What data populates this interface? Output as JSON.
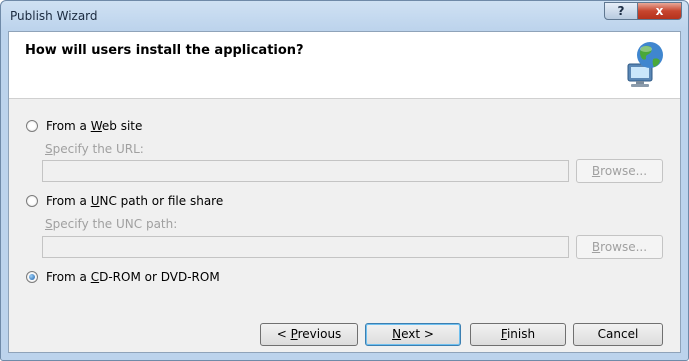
{
  "window": {
    "title": "Publish Wizard",
    "help": "?",
    "close": "x"
  },
  "header": {
    "question": "How will users install the application?"
  },
  "options": {
    "web": {
      "pre": "From a ",
      "key": "W",
      "post": "eb site",
      "selected": false
    },
    "web_url": {
      "key": "S",
      "post": "pecify the URL:",
      "value": "",
      "browse_pre": "",
      "browse_key": "B",
      "browse_post": "rowse..."
    },
    "unc": {
      "pre": "From a ",
      "key": "U",
      "post": "NC path or file share",
      "selected": false
    },
    "unc_path": {
      "key": "S",
      "post": "pecify the UNC path:",
      "value": "",
      "browse_key": "B",
      "browse_post": "rowse..."
    },
    "cd": {
      "pre": "From a ",
      "key": "C",
      "post": "D-ROM or DVD-ROM",
      "selected": true
    }
  },
  "buttons": {
    "previous": {
      "pre": "< ",
      "key": "P",
      "post": "revious"
    },
    "next": {
      "key": "N",
      "post": "ext >"
    },
    "finish": {
      "key": "F",
      "post": "inish"
    },
    "cancel": "Cancel"
  }
}
